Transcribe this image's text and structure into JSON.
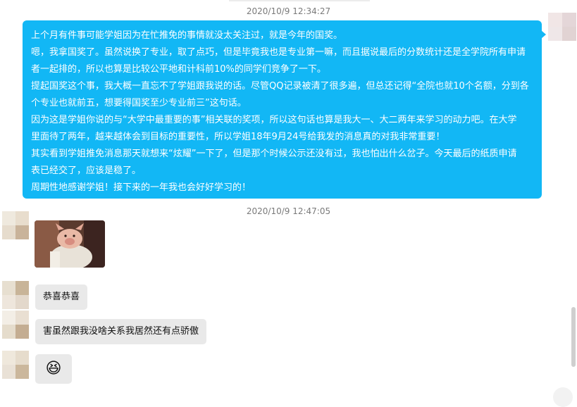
{
  "chat": {
    "timestamp_1": "2020/10/9 12:34:27",
    "timestamp_2": "2020/10/9 12:47:05",
    "outgoing_message": {
      "lines": [
        "上个月有件事可能学姐因为在忙推免的事情就没太关注过，就是今年的国奖。",
        "嗯，我拿国奖了。虽然说换了专业，取了点巧，但是毕竟我也是专业第一嘛，而且据说最后的分数统计还是全学院所有申请",
        "者一起排的，所以也算是比较公平地和计科前10%的同学们竞争了一下。",
        "提起国奖这个事，我大概一直忘不了学姐跟我说的话。尽管QQ记录被清了很多遍，但总还记得“全院也就10个名额，分到各",
        "个专业也就前五，想要得国奖至少专业前三”这句话。",
        "因为这是学姐你说的与“大学中最重要的事”相关联的奖项，所以这句话也算是我大一、大二两年来学习的动力吧。在大学",
        "里面待了两年，越来越体会到目标的重要性，所以学姐18年9月24号给我发的消息真的对我非常重要！",
        "其实看到学姐推免消息那天就想来“炫耀”一下了，但是那个时候公示还没有过，我也怕出什么岔子。今天最后的纸质申请",
        "表已经交了，应该是稳了。",
        "周期性地感谢学姐！接下来的一年我也会好好学习的！"
      ]
    },
    "incoming_messages": [
      {
        "text": "恭喜恭喜"
      },
      {
        "text": "害虽然跟我没啥关系我居然还有点骄傲"
      },
      {
        "emoji": "😆"
      }
    ],
    "colors": {
      "outgoing_bubble": "#12b7f5",
      "incoming_bubble": "#e9e9e9"
    }
  }
}
